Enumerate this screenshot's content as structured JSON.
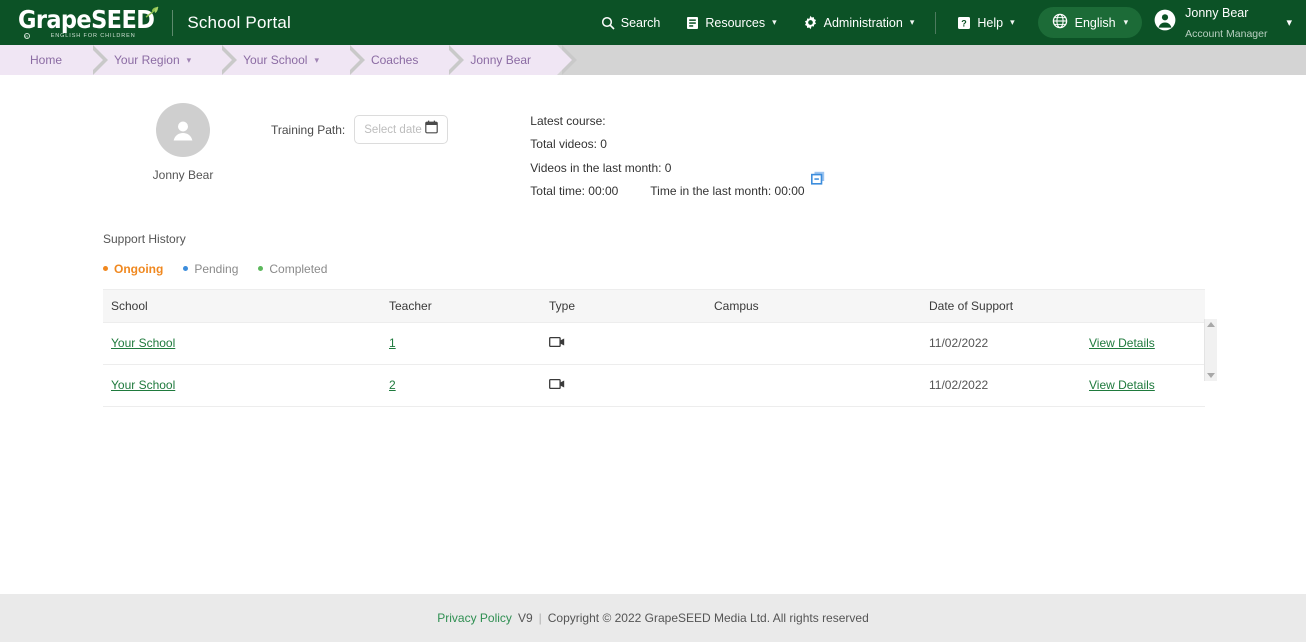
{
  "header": {
    "logo_text": "GrapeSEED",
    "logo_tagline": "ENGLISH FOR CHILDREN",
    "portal_title": "School Portal",
    "nav": [
      {
        "label": "Search",
        "icon": "search-icon",
        "caret": false
      },
      {
        "label": "Resources",
        "icon": "book-icon",
        "caret": true
      },
      {
        "label": "Administration",
        "icon": "gear-icon",
        "caret": true
      },
      {
        "label": "Help",
        "icon": "help-icon",
        "caret": true
      }
    ],
    "language": {
      "label": "English",
      "icon": "globe-icon",
      "caret": "⌄"
    },
    "user": {
      "name": "Jonny Bear",
      "role": "Account Manager",
      "caret": "⌄"
    },
    "colors": {
      "bar": "#0c5226",
      "pill": "#1c6b37",
      "leaf": "#8fc14e"
    }
  },
  "breadcrumb": {
    "items": [
      {
        "label": "Home",
        "caret": ""
      },
      {
        "label": "Your Region",
        "caret": "⌄"
      },
      {
        "label": "Your School",
        "caret": "⌄"
      },
      {
        "label": "Coaches",
        "caret": ""
      },
      {
        "label": "Jonny Bear",
        "caret": ""
      }
    ],
    "colors": {
      "fill": "#f0e6f4",
      "text": "#8b6ba3",
      "track": "#d4d4d4"
    }
  },
  "profile": {
    "avatar_name": "Jonny Bear",
    "training_path_label": "Training Path:",
    "date_placeholder": "Select date"
  },
  "stats": {
    "latest_course": "Latest course:",
    "total_videos": "Total videos: 0",
    "videos_last_month": "Videos in the last month: 0",
    "total_time": "Total time: 00:00",
    "time_last_month": "Time in the last month: 00:00"
  },
  "support_history": {
    "title": "Support History",
    "legend": [
      {
        "label": "Ongoing",
        "color": "#f0881f",
        "active": true
      },
      {
        "label": "Pending",
        "color": "#3c8ddc",
        "active": false
      },
      {
        "label": "Completed",
        "color": "#5cb85c",
        "active": false
      }
    ],
    "columns": [
      "School",
      "Teacher",
      "Type",
      "Campus",
      "Date of Support",
      ""
    ],
    "rows": [
      {
        "school": "Your School",
        "teacher": "1",
        "type_icon": "video-camera-icon",
        "campus": "",
        "date": "11/02/2022",
        "action": "View Details"
      },
      {
        "school": "Your School",
        "teacher": "2",
        "type_icon": "video-camera-icon",
        "campus": "",
        "date": "11/02/2022",
        "action": "View Details"
      }
    ]
  },
  "footer": {
    "privacy": "Privacy Policy",
    "version": "V9",
    "separator": "|",
    "copyright": "Copyright © 2022 GrapeSEED Media Ltd. All rights reserved"
  }
}
